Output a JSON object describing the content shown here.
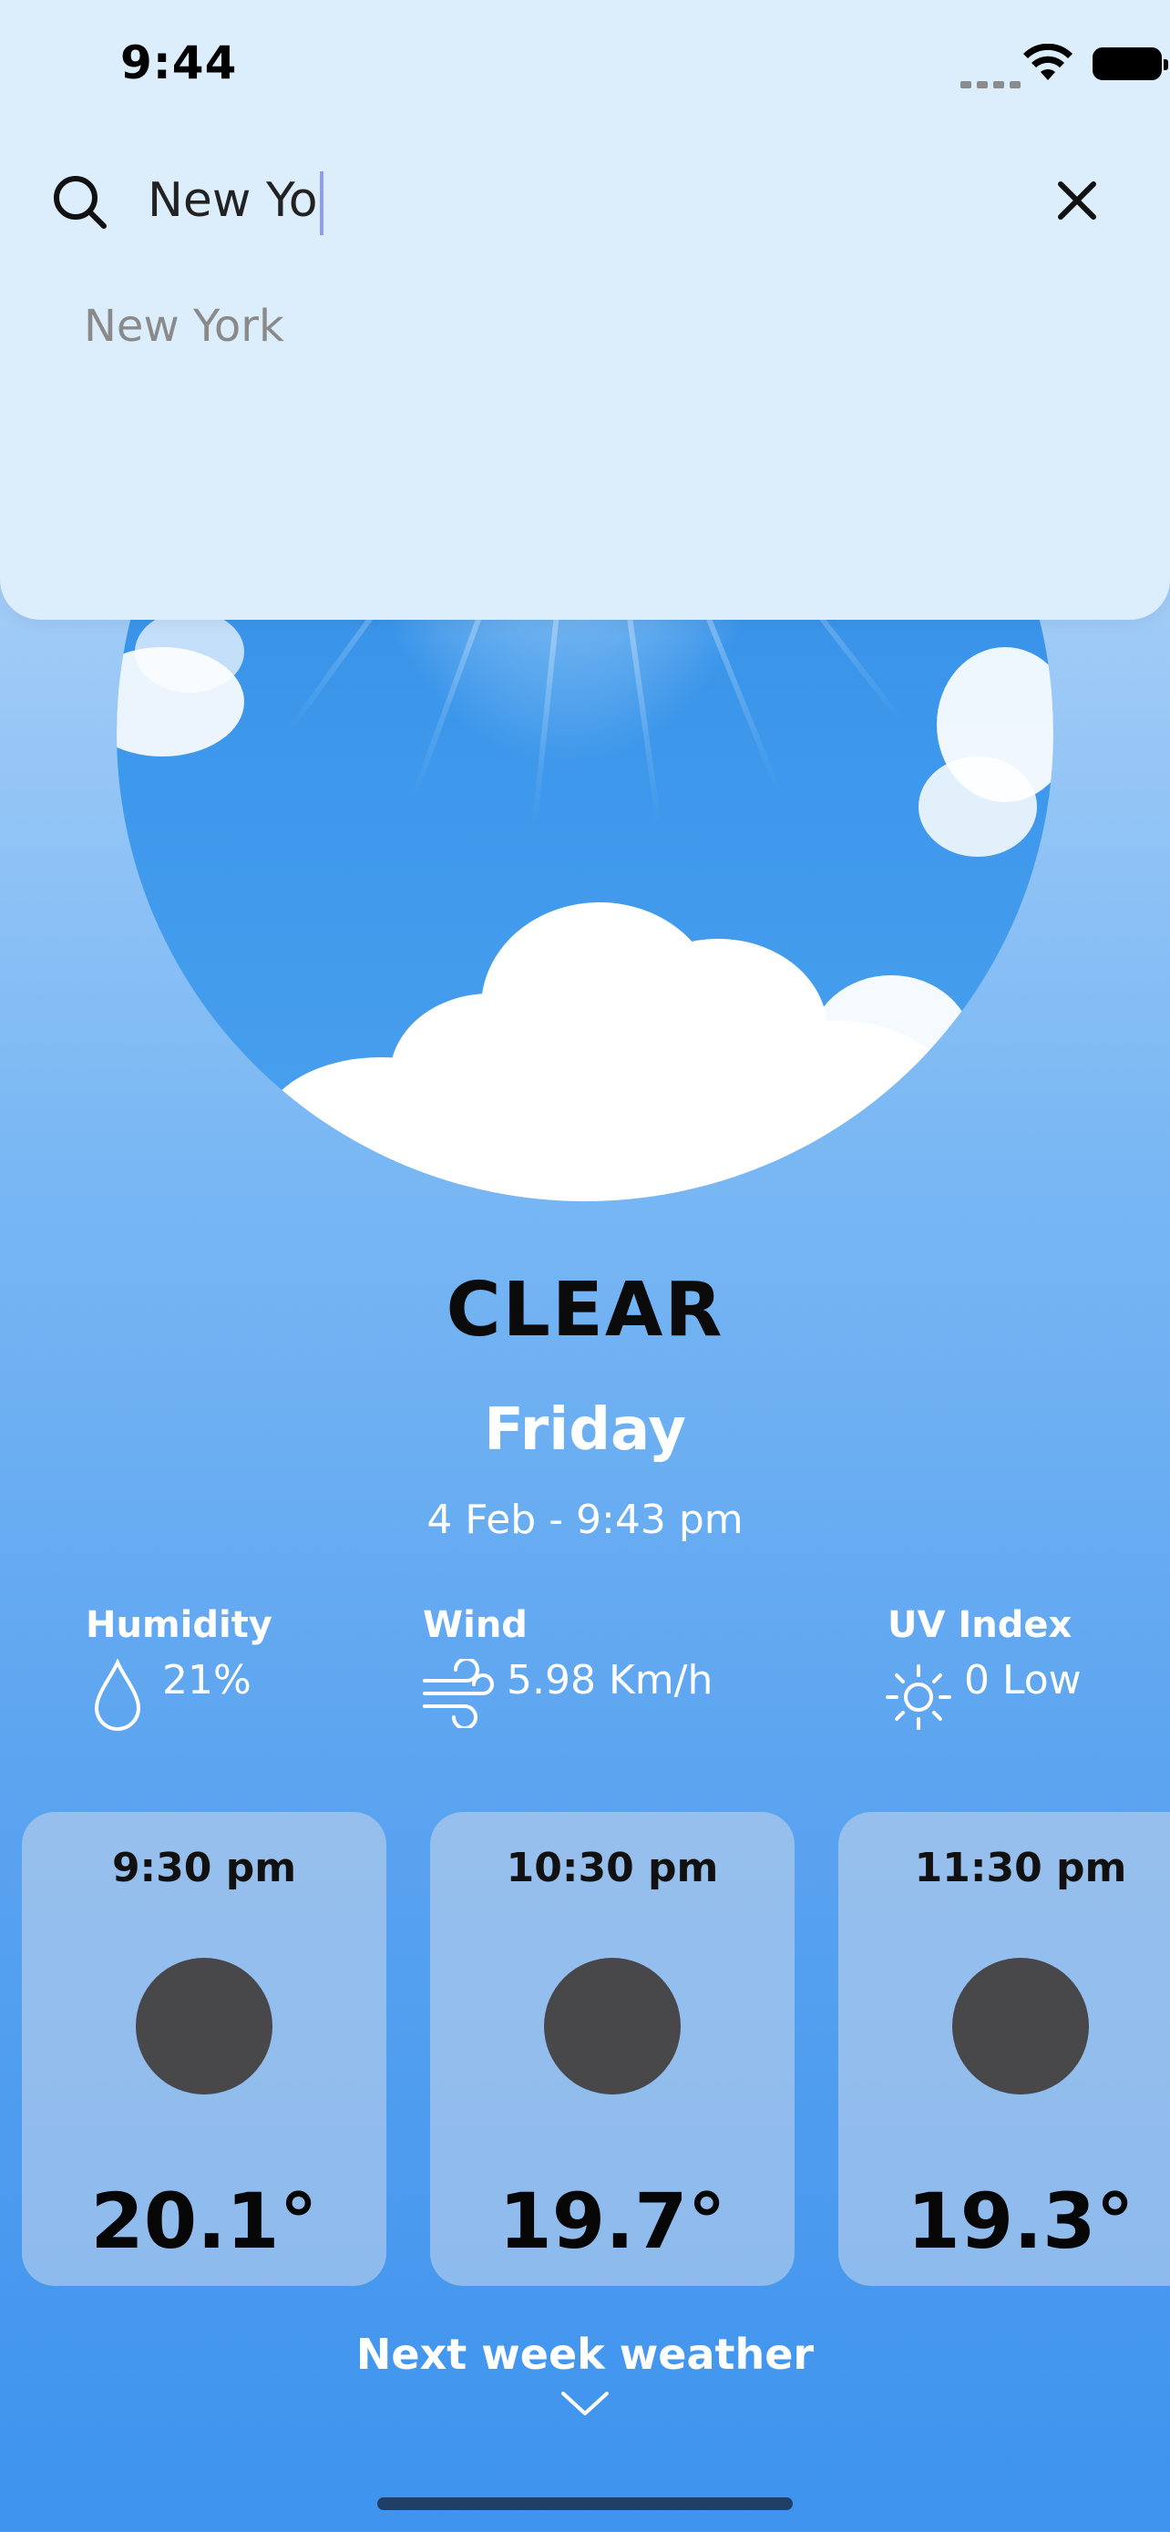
{
  "status_bar": {
    "time": "9:44"
  },
  "search": {
    "query": "New Yo",
    "suggestions": [
      "New York"
    ]
  },
  "weather": {
    "condition": "CLEAR",
    "day": "Friday",
    "datetime": "4 Feb - 9:43 pm",
    "metrics": {
      "humidity": {
        "label": "Humidity",
        "value": "21%",
        "icon": "droplet-icon"
      },
      "wind": {
        "label": "Wind",
        "value": "5.98 Km/h",
        "icon": "wind-icon"
      },
      "uv": {
        "label": "UV Index",
        "value": "0 Low",
        "icon": "sun-icon"
      }
    }
  },
  "hourly": [
    {
      "time": "9:30 pm",
      "temp": "20.1°"
    },
    {
      "time": "10:30 pm",
      "temp": "19.7°"
    },
    {
      "time": "11:30 pm",
      "temp": "19.3°"
    }
  ],
  "footer": {
    "next_week_label": "Next week weather"
  },
  "colors": {
    "sheet_bg": "#dcedfc",
    "card_bg": "#c8d7eb",
    "accent_cursor": "#8d9ef0",
    "weather_icon_placeholder": "#48474a"
  }
}
